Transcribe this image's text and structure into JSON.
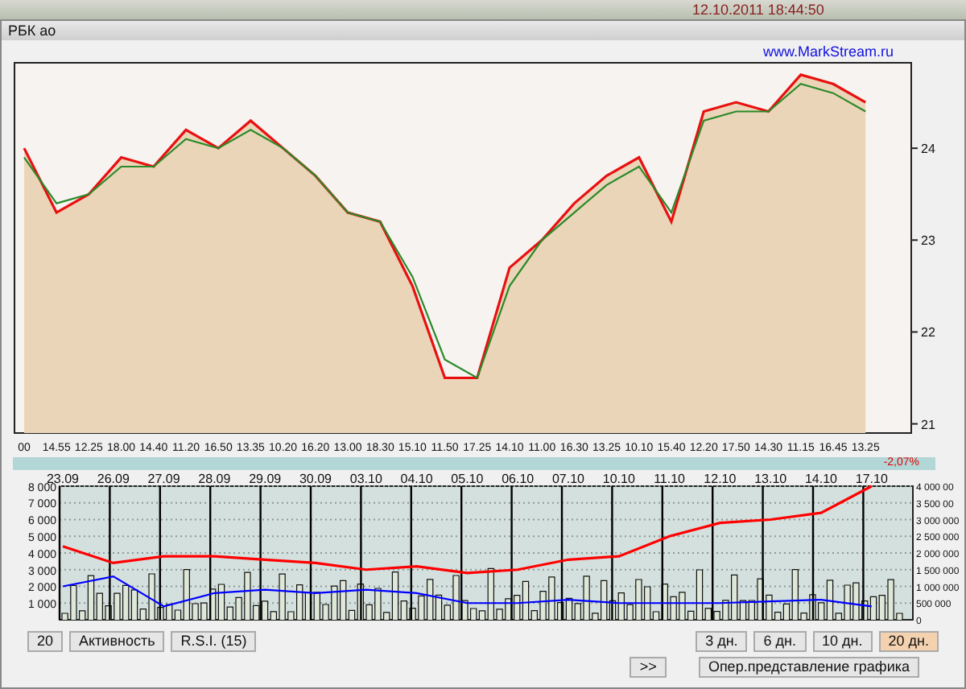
{
  "background_window": {
    "text": "12.10.2011   18:44:50"
  },
  "window": {
    "title": "РБК ао"
  },
  "source_link": "www.MarkStream.ru",
  "price_chart": {
    "chart_data": {
      "type": "area",
      "categories": [
        "00",
        "14.55",
        "12.25",
        "18.00",
        "14.40",
        "11.20",
        "16.50",
        "13.35",
        "10.20",
        "16.20",
        "13.00",
        "18.30",
        "15.10",
        "11.50",
        "17.25",
        "14.10",
        "11.00",
        "16.30",
        "13.25",
        "10.10",
        "15.40",
        "12.20",
        "17.50",
        "14.30",
        "11.15",
        "16.45",
        "13.25"
      ],
      "series": [
        {
          "type": "area",
          "color": "#e81010",
          "values": [
            24.0,
            23.3,
            23.5,
            23.9,
            23.8,
            24.2,
            24.0,
            24.3,
            24.0,
            23.7,
            23.3,
            23.2,
            22.5,
            21.5,
            21.5,
            22.7,
            23.0,
            23.4,
            23.7,
            23.9,
            23.2,
            24.4,
            24.5,
            24.4,
            24.8,
            24.7,
            24.5
          ]
        },
        {
          "type": "line",
          "color": "#2a8a2a",
          "values": [
            23.9,
            23.4,
            23.5,
            23.8,
            23.8,
            24.1,
            24.0,
            24.2,
            24.0,
            23.7,
            23.3,
            23.2,
            22.6,
            21.7,
            21.5,
            22.5,
            23.0,
            23.3,
            23.6,
            23.8,
            23.3,
            24.3,
            24.4,
            24.4,
            24.7,
            24.6,
            24.4
          ]
        }
      ],
      "ylim": [
        20.9,
        24.93
      ],
      "yticks": [
        21,
        22,
        23,
        24
      ]
    }
  },
  "change": "-2,07%",
  "activity_chart": {
    "chart_data": {
      "type": "line",
      "categories": [
        "23.09",
        "26.09",
        "27.09",
        "28.09",
        "29.09",
        "30.09",
        "03.10",
        "04.10",
        "05.10",
        "06.10",
        "07.10",
        "10.10",
        "11.10",
        "12.10",
        "13.10",
        "14.10",
        "17.10"
      ],
      "series": [
        {
          "color": "#ff0000",
          "values": [
            2200000,
            1700000,
            1900000,
            1900000,
            1800000,
            1700000,
            1500000,
            1600000,
            1400000,
            1500000,
            1800000,
            1900000,
            2500000,
            2900000,
            3000000,
            3200000,
            4000000
          ]
        },
        {
          "color": "#0000ff",
          "values": [
            1000000,
            1300000,
            400000,
            800000,
            900000,
            800000,
            900000,
            800000,
            500000,
            500000,
            600000,
            500000,
            500000,
            500000,
            550000,
            600000,
            400000
          ]
        }
      ],
      "ylim": [
        0,
        4000000
      ],
      "grid": true,
      "yticks": [
        {
          "value": 0,
          "label": "0"
        },
        {
          "value": 500000,
          "label": "500 000"
        },
        {
          "value": 1000000,
          "label": "1 000 000"
        },
        {
          "value": 1500000,
          "label": "1 500 000"
        },
        {
          "value": 2000000,
          "label": "2 000 000"
        },
        {
          "value": 2500000,
          "label": "2 500 000"
        },
        {
          "value": 3000000,
          "label": "3 000 000"
        },
        {
          "value": 3500000,
          "label": "3 500 00"
        },
        {
          "value": 4000000,
          "label": "4 000 00"
        }
      ]
    },
    "left_axis_labels": [
      "8 000",
      "7 000",
      "6 000",
      "5 000",
      "4 000",
      "3 000",
      "2 000",
      "1 000"
    ]
  },
  "indicator_buttons": [
    "20",
    "Активность",
    "R.S.I.  (15)"
  ],
  "period_buttons": [
    {
      "label": "3 дн.",
      "selected": false
    },
    {
      "label": "6 дн.",
      "selected": false
    },
    {
      "label": "10 дн.",
      "selected": false
    },
    {
      "label": "20 дн.",
      "selected": true
    }
  ],
  "scroll_button": ">>",
  "mode_button": "Опер.представление графика"
}
